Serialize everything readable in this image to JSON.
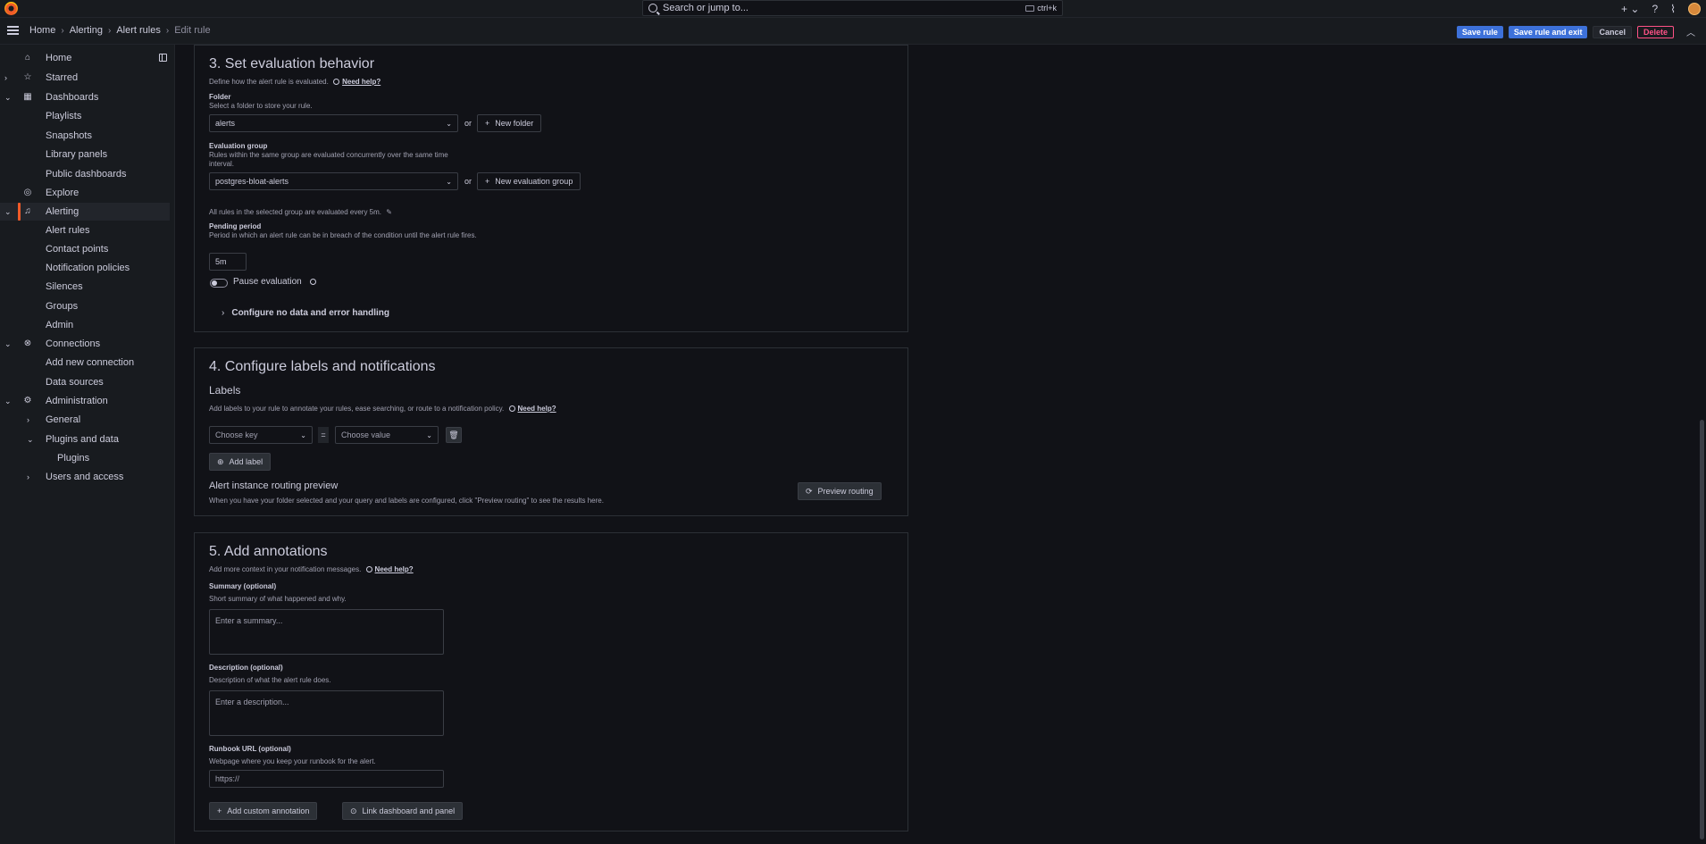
{
  "topbar": {
    "search_placeholder": "Search or jump to...",
    "shortcut": "ctrl+k",
    "plus_label": "+",
    "help_icon": "help-icon",
    "news_icon": "rss-icon"
  },
  "breadcrumb": [
    {
      "label": "Home"
    },
    {
      "label": "Alerting"
    },
    {
      "label": "Alert rules"
    },
    {
      "label": "Edit rule"
    }
  ],
  "actions": {
    "save": "Save rule",
    "save_exit": "Save rule and exit",
    "cancel": "Cancel",
    "delete": "Delete"
  },
  "sidebar": {
    "items": [
      {
        "label": "Home",
        "icon": "home-icon",
        "chevron": ""
      },
      {
        "label": "Starred",
        "icon": "star-icon",
        "chevron": "›"
      },
      {
        "label": "Dashboards",
        "icon": "apps-icon",
        "chevron": "⌄"
      },
      {
        "label": "Playlists"
      },
      {
        "label": "Snapshots"
      },
      {
        "label": "Library panels"
      },
      {
        "label": "Public dashboards"
      },
      {
        "label": "Explore",
        "icon": "compass-icon",
        "chevron": ""
      },
      {
        "label": "Alerting",
        "icon": "bell-icon",
        "chevron": "⌄"
      },
      {
        "label": "Alert rules"
      },
      {
        "label": "Contact points"
      },
      {
        "label": "Notification policies"
      },
      {
        "label": "Silences"
      },
      {
        "label": "Groups"
      },
      {
        "label": "Admin"
      },
      {
        "label": "Connections",
        "icon": "link-icon",
        "chevron": "⌄"
      },
      {
        "label": "Add new connection"
      },
      {
        "label": "Data sources"
      },
      {
        "label": "Administration",
        "icon": "cog-icon",
        "chevron": "⌄"
      },
      {
        "label": "General",
        "chevron": "›"
      },
      {
        "label": "Plugins and data",
        "chevron": "⌄"
      },
      {
        "label": "Plugins"
      },
      {
        "label": "Users and access",
        "chevron": "›"
      }
    ]
  },
  "section3": {
    "title": "3. Set evaluation behavior",
    "desc": "Define how the alert rule is evaluated.",
    "need_help": "Need help?",
    "folder_label": "Folder",
    "folder_desc": "Select a folder to store your rule.",
    "folder_value": "alerts",
    "or": "or",
    "new_folder": "New folder",
    "group_label": "Evaluation group",
    "group_desc": "Rules within the same group are evaluated concurrently over the same time interval.",
    "group_value": "postgres-bloat-alerts",
    "new_group": "New evaluation group",
    "group_note": "All rules in the selected group are evaluated every 5m.",
    "pending_label": "Pending period",
    "pending_desc": "Period in which an alert rule can be in breach of the condition until the alert rule fires.",
    "pending_value": "5m",
    "pause_label": "Pause evaluation",
    "configure_nodata": "Configure no data and error handling"
  },
  "section4": {
    "title": "4. Configure labels and notifications",
    "labels_title": "Labels",
    "labels_desc": "Add labels to your rule to annotate your rules, ease searching, or route to a notification policy.",
    "need_help": "Need help?",
    "key_placeholder": "Choose key",
    "eq": "=",
    "value_placeholder": "Choose value",
    "add_label": "Add label",
    "routing_title": "Alert instance routing preview",
    "routing_desc": "When you have your folder selected and your query and labels are configured, click \"Preview routing\" to see the results here.",
    "preview_routing": "Preview routing"
  },
  "section5": {
    "title": "5. Add annotations",
    "desc": "Add more context in your notification messages.",
    "need_help": "Need help?",
    "summary_label": "Summary (optional)",
    "summary_desc": "Short summary of what happened and why.",
    "summary_placeholder": "Enter a summary...",
    "description_label": "Description (optional)",
    "description_desc": "Description of what the alert rule does.",
    "description_placeholder": "Enter a description...",
    "runbook_label": "Runbook URL (optional)",
    "runbook_desc": "Webpage where you keep your runbook for the alert.",
    "runbook_placeholder": "https://",
    "add_custom": "Add custom annotation",
    "link_dashboard": "Link dashboard and panel"
  }
}
